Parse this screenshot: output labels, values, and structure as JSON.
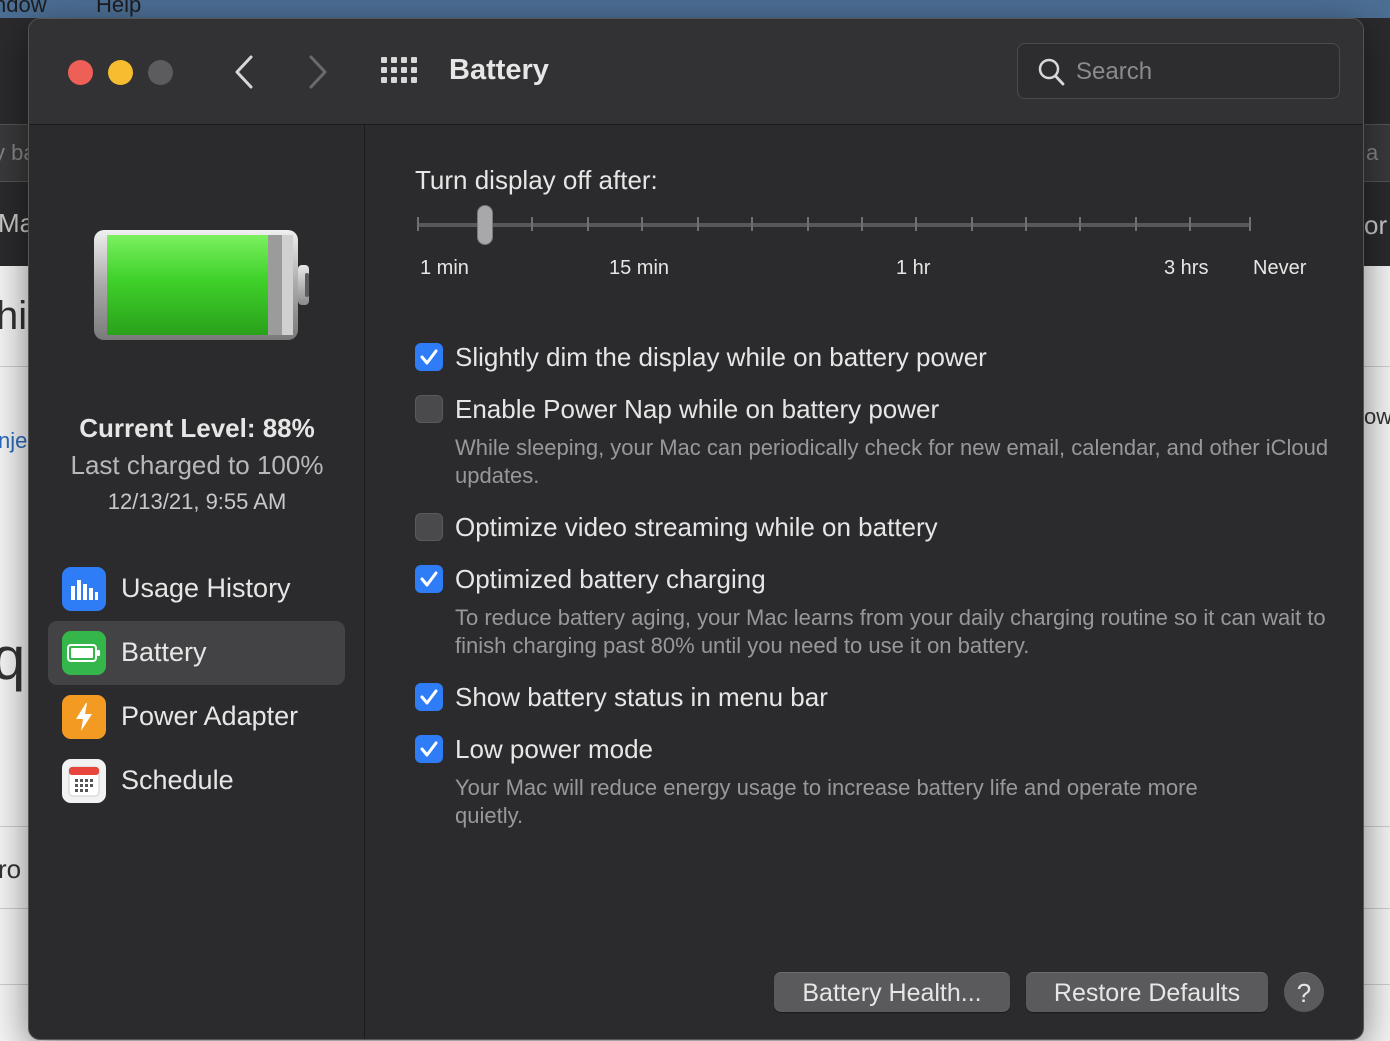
{
  "background_app": {
    "menubar_items": [
      "ndow",
      "Help"
    ],
    "fragments_left": [
      "y ba",
      "Ma",
      "hi",
      "nje",
      "qu",
      "ro"
    ],
    "fragments_right": [
      "a",
      "or",
      "ow"
    ]
  },
  "window": {
    "title": "Battery",
    "search_placeholder": "Search"
  },
  "sidebar": {
    "current_level": "Current Level: 88%",
    "last_charged": "Last charged to 100%",
    "charged_time": "12/13/21, 9:55 AM",
    "battery_level_fraction": 0.88,
    "items": [
      {
        "label": "Usage History",
        "icon": "bar-chart-icon",
        "active": false
      },
      {
        "label": "Battery",
        "icon": "battery-icon",
        "active": true
      },
      {
        "label": "Power Adapter",
        "icon": "lightning-bolt-icon",
        "active": false
      },
      {
        "label": "Schedule",
        "icon": "calendar-icon",
        "active": false
      }
    ]
  },
  "main": {
    "slider": {
      "title": "Turn display off after:",
      "labels": [
        "1 min",
        "15 min",
        "1 hr",
        "3 hrs",
        "Never"
      ],
      "selected_tick_index": 2,
      "tick_count": 16
    },
    "options": [
      {
        "label": "Slightly dim the display while on battery power",
        "checked": true,
        "description": ""
      },
      {
        "label": "Enable Power Nap while on battery power",
        "checked": false,
        "description": "While sleeping, your Mac can periodically check for new email, calendar, and other iCloud updates."
      },
      {
        "label": "Optimize video streaming while on battery",
        "checked": false,
        "description": ""
      },
      {
        "label": "Optimized battery charging",
        "checked": true,
        "description": "To reduce battery aging, your Mac learns from your daily charging routine so it can wait to finish charging past 80% until you need to use it on battery."
      },
      {
        "label": "Show battery status in menu bar",
        "checked": true,
        "description": ""
      },
      {
        "label": "Low power mode",
        "checked": true,
        "description": "Your Mac will reduce energy usage to increase battery life and operate more quietly."
      }
    ],
    "buttons": {
      "battery_health": "Battery Health...",
      "restore_defaults": "Restore Defaults",
      "help": "?"
    }
  },
  "colors": {
    "accent": "#2f7df6",
    "battery_green": "#35c53a",
    "close": "#ee5f57",
    "minimize": "#f5bd2f"
  }
}
